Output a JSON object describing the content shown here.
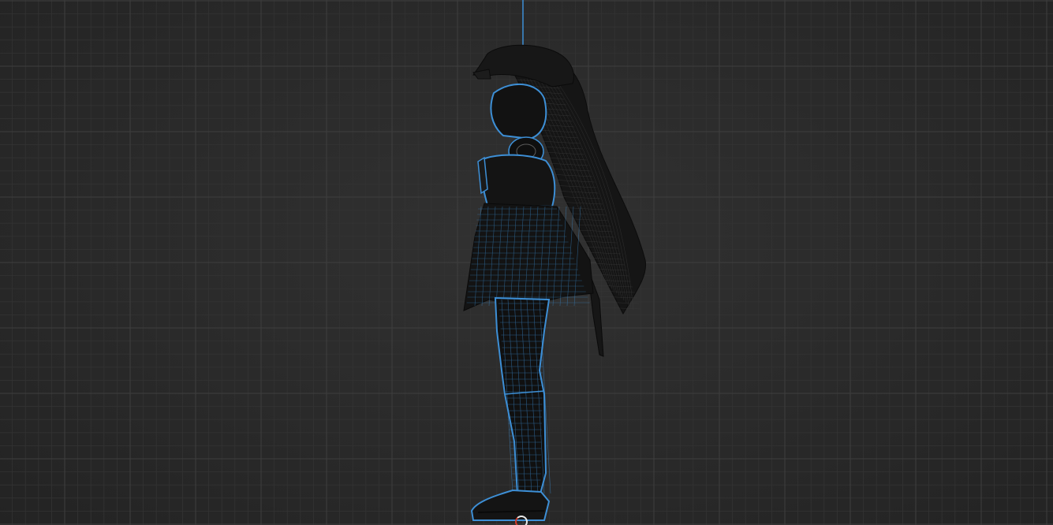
{
  "viewport": {
    "view": "side-orthographic",
    "display_mode": "wireframe",
    "grid": true,
    "colors": {
      "background": "#2b2b2b",
      "grid_minor": "#333333",
      "grid_major": "#3e3e3e",
      "selection_outline": "#3d8fd6",
      "wire": "#111111",
      "origin_ring": "#e8e8e8",
      "origin_accent": "#d23a2a"
    }
  },
  "scene": {
    "objects": [
      {
        "name_icon": "character-mesh",
        "selected": true
      }
    ]
  }
}
